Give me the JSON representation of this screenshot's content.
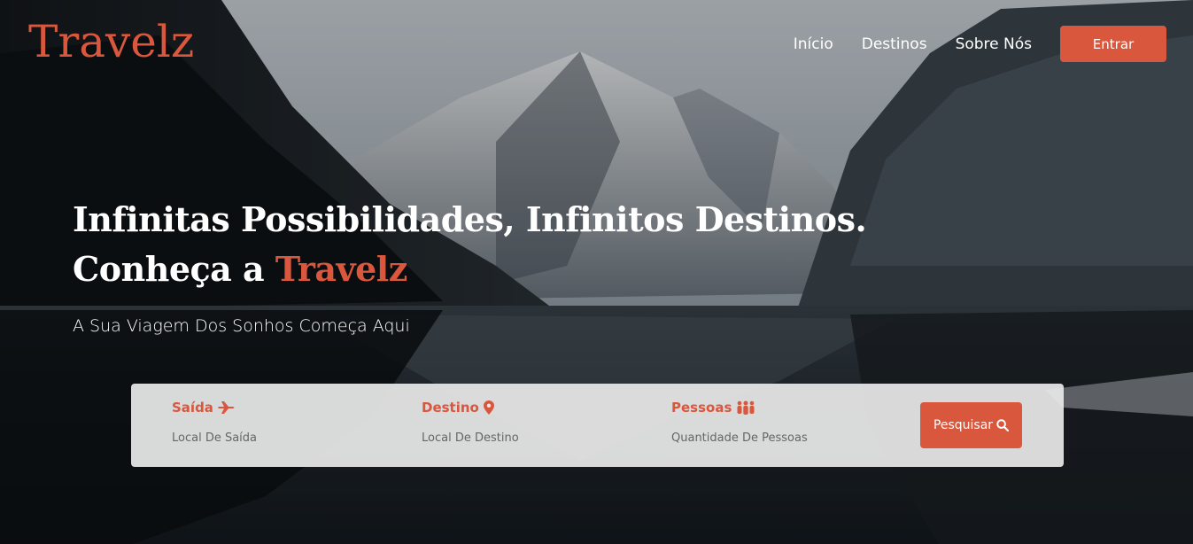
{
  "brand": {
    "logo": "Travelz",
    "accent_color": "#d9573d"
  },
  "nav": {
    "items": [
      "Início",
      "Destinos",
      "Sobre Nós"
    ],
    "login_label": "Entrar"
  },
  "hero": {
    "headline_line1": "Infinitas Possibilidades, Infinitos Destinos.",
    "headline_line2_prefix": "Conheça a ",
    "headline_line2_accent": "Travelz",
    "subtitle": "A Sua Viagem Dos Sonhos Começa Aqui"
  },
  "search": {
    "fields": [
      {
        "label": "Saída",
        "icon": "plane-icon",
        "placeholder": "Local De Saída"
      },
      {
        "label": "Destino",
        "icon": "map-pin-icon",
        "placeholder": "Local De Destino"
      },
      {
        "label": "Pessoas",
        "icon": "people-icon",
        "placeholder": "Quantidade De Pessoas"
      }
    ],
    "button_label": "Pesquisar",
    "button_icon": "search-icon"
  }
}
